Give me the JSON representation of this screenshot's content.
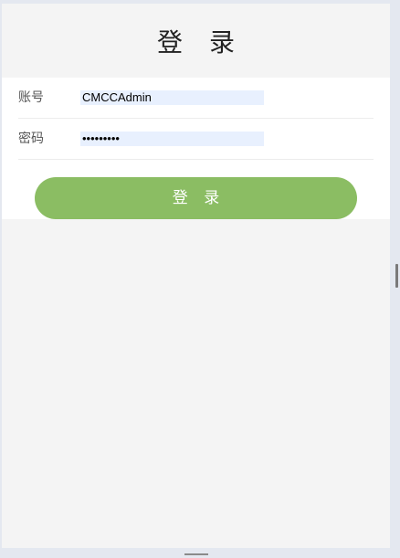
{
  "page": {
    "title": "登 录"
  },
  "form": {
    "account_label": "账号",
    "account_value": "CMCCAdmin",
    "password_label": "密码",
    "password_value": "*********",
    "submit_label": "登 录"
  }
}
